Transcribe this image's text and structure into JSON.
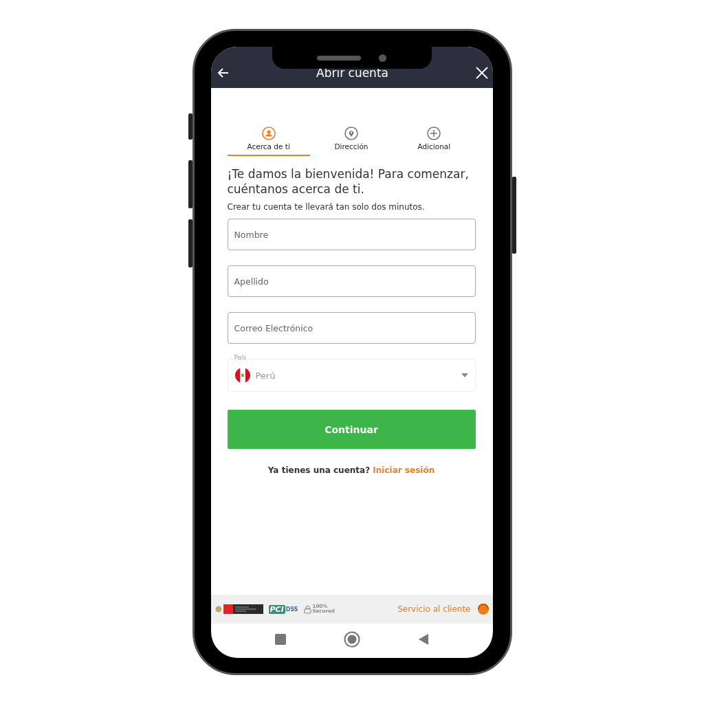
{
  "header": {
    "title": "Abrir cuenta"
  },
  "steps": [
    {
      "label": "Acerca de ti",
      "selected": true,
      "kind": "person"
    },
    {
      "label": "Dirección",
      "selected": false,
      "kind": "pin"
    },
    {
      "label": "Adicional",
      "selected": false,
      "kind": "plus"
    }
  ],
  "heading": "¡Te damos la bienvenida! Para comenzar, cuéntanos acerca de ti.",
  "subtitle": "Crear tu cuenta te llevará tan solo dos minutos.",
  "fields": [
    {
      "placeholder": "Nombre"
    },
    {
      "placeholder": "Apellido"
    },
    {
      "placeholder": "Correo Electrónico"
    }
  ],
  "country": {
    "label": "País",
    "value": "Perú"
  },
  "submit": "Continuar",
  "login": {
    "prompt": "Ya tienes una cuenta?",
    "link": "Iniciar sesión"
  },
  "footer": {
    "pci": "PCI",
    "dss": "DSS",
    "secured_percent": "100%",
    "secured": "Secured",
    "support": "Servicio al cliente"
  }
}
